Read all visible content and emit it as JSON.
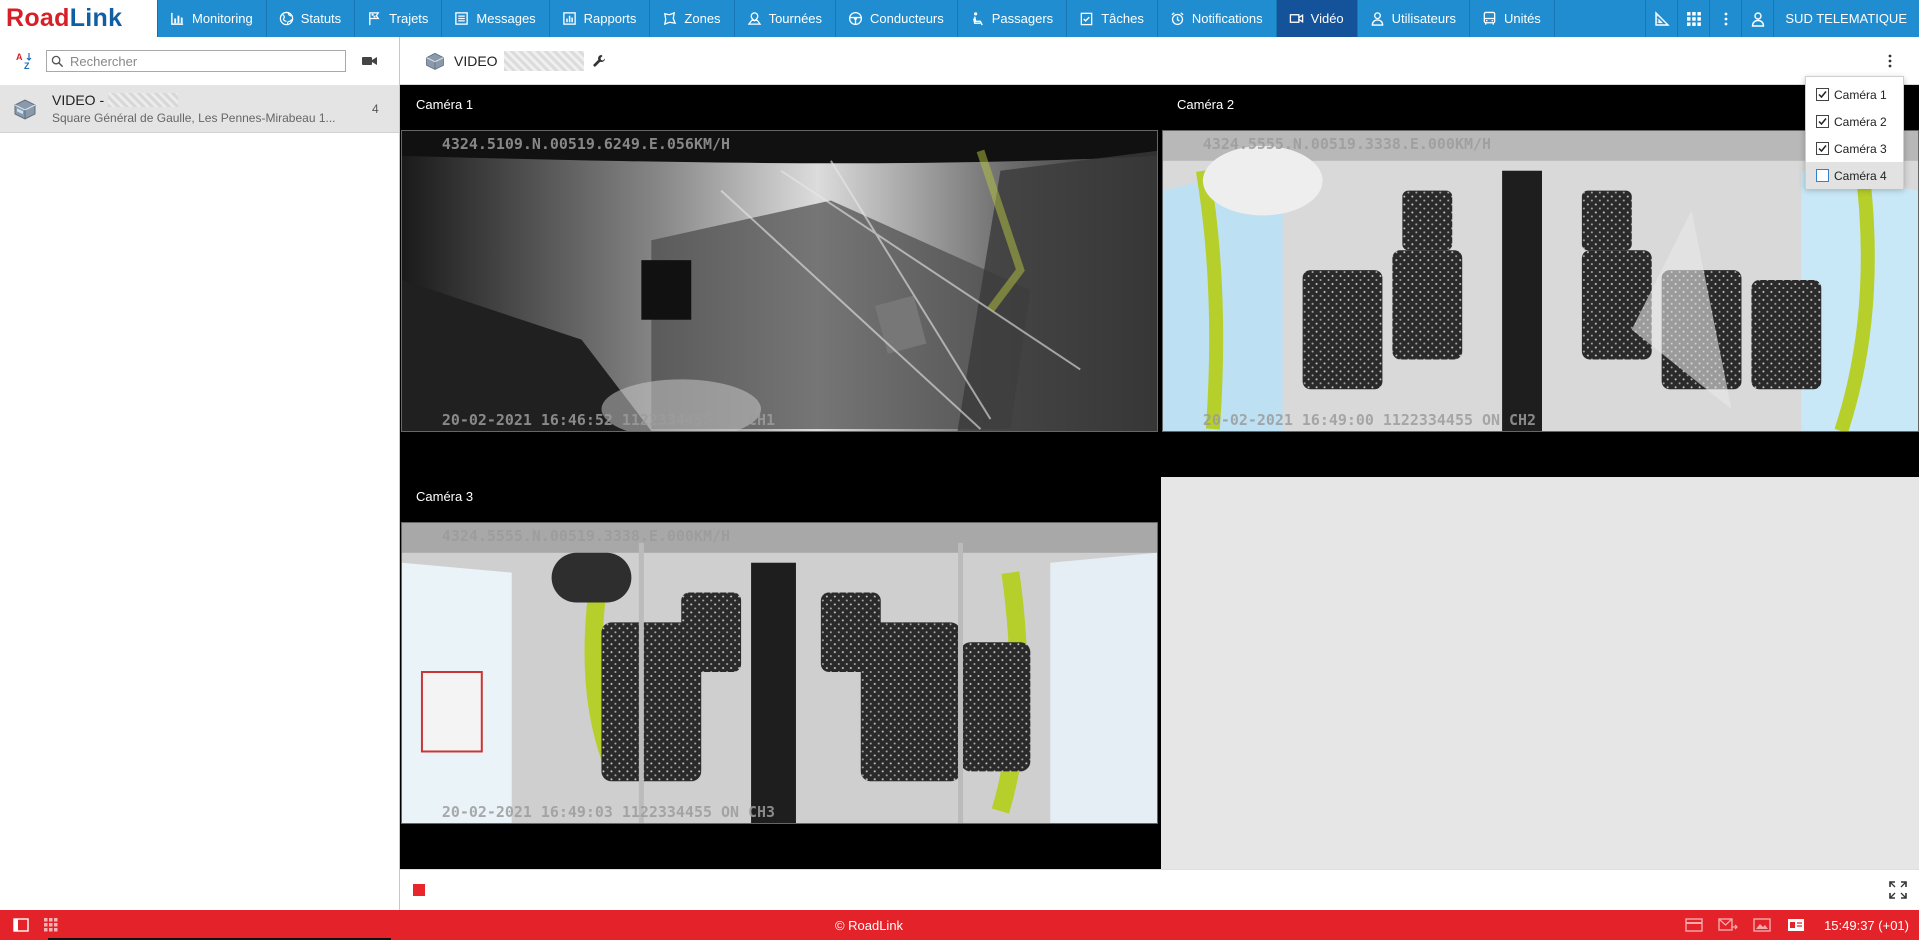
{
  "app": {
    "logo_part1": "Road",
    "logo_part2": "Link"
  },
  "nav": {
    "items": [
      {
        "label": "Monitoring",
        "icon": "bar-chart-icon"
      },
      {
        "label": "Statuts",
        "icon": "globe-icon"
      },
      {
        "label": "Trajets",
        "icon": "flag-route-icon"
      },
      {
        "label": "Messages",
        "icon": "message-list-icon"
      },
      {
        "label": "Rapports",
        "icon": "report-chart-icon"
      },
      {
        "label": "Zones",
        "icon": "zone-polygon-icon"
      },
      {
        "label": "Tournées",
        "icon": "map-pin-icon"
      },
      {
        "label": "Conducteurs",
        "icon": "steering-wheel-icon"
      },
      {
        "label": "Passagers",
        "icon": "passenger-seat-icon"
      },
      {
        "label": "Tâches",
        "icon": "task-check-icon"
      },
      {
        "label": "Notifications",
        "icon": "alarm-clock-icon"
      },
      {
        "label": "Vidéo",
        "icon": "video-camera-icon",
        "active": true
      },
      {
        "label": "Utilisateurs",
        "icon": "user-icon"
      },
      {
        "label": "Unités",
        "icon": "bus-icon"
      }
    ],
    "account": "SUD TELEMATIQUE",
    "active_color": "#14529a",
    "bar_color": "#1f8dd0"
  },
  "left": {
    "search_placeholder": "Rechercher",
    "vehicle": {
      "name": "VIDEO -",
      "address": "Square Général de Gaulle, Les Pennes-Mirabeau 1...",
      "count": "4"
    }
  },
  "main": {
    "title": "VIDEO",
    "cameras": [
      {
        "label": "Caméra 1",
        "overlay_top": "4324.5109.N.00519.6249.E.056KM/H",
        "overlay_bottom": "20-02-2021 16:46:52 1122334455 ON  CH1"
      },
      {
        "label": "Caméra 2",
        "overlay_top": "4324.5555.N.00519.3338.E.000KM/H",
        "overlay_bottom": "20-02-2021 16:49:00 1122334455 ON  CH2"
      },
      {
        "label": "Caméra 3",
        "overlay_top": "4324.5555.N.00519.3338.E.000KM/H",
        "overlay_bottom": "20-02-2021 16:49:03 1122334455 ON  CH3"
      }
    ],
    "dropdown": [
      {
        "label": "Caméra 1",
        "checked": true
      },
      {
        "label": "Caméra 2",
        "checked": true
      },
      {
        "label": "Caméra 3",
        "checked": true
      },
      {
        "label": "Caméra 4",
        "checked": false
      }
    ]
  },
  "footer": {
    "copyright": "© RoadLink",
    "time": "15:49:37 (+01)",
    "bar_color": "#e32229"
  }
}
